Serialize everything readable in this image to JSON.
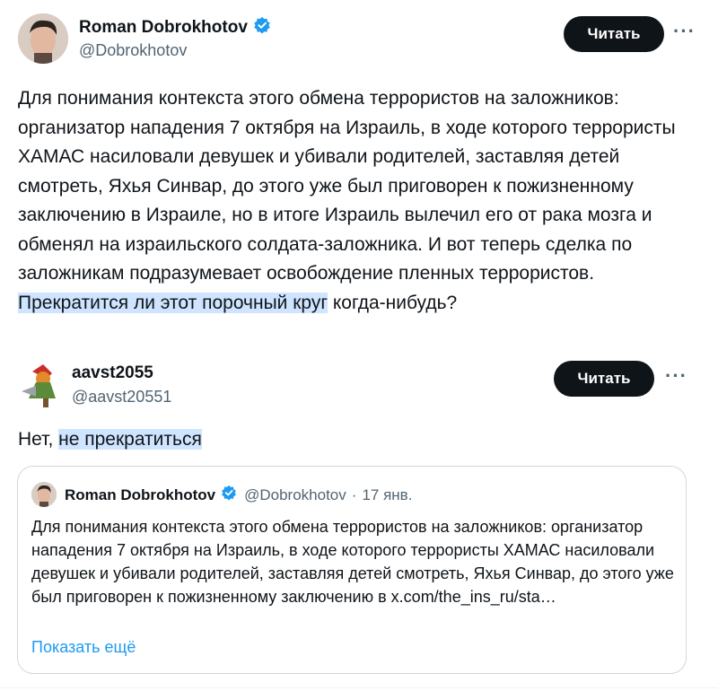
{
  "main_tweet": {
    "name": "Roman Dobrokhotov",
    "handle": "@Dobrokhotov",
    "follow_label": "Читать",
    "more_label": "···",
    "text_before": "Для понимания контекста этого обмена террористов на заложников: организатор нападения 7 октября на Израиль, в ходе которого террористы ХАМАС насиловали девушек и убивали родителей, заставляя детей смотреть, Яхья  Синвар, до этого уже был приговорен к пожизненному заключению в Израиле, но в итоге Израиль вылечил его от рака мозга и обменял на израильского солдата-заложника. И вот теперь сделка по заложникам подразумевает освобождение пленных террористов. ",
    "text_highlight": "Прекратится ли этот порочный круг",
    "text_after": " когда-нибудь?"
  },
  "reply_tweet": {
    "name": "aavst2055",
    "handle": "@aavst20551",
    "follow_label": "Читать",
    "more_label": "···",
    "text_before": "Нет, ",
    "text_highlight": "не прекратиться"
  },
  "quoted_tweet": {
    "name": "Roman Dobrokhotov",
    "handle": "@Dobrokhotov",
    "separator": "·",
    "date": "17 янв.",
    "text": "Для понимания контекста этого обмена террористов на заложников: организатор нападения 7 октября на Израиль, в ходе которого террористы ХАМАС насиловали девушек и убивали родителей, заставляя детей смотреть, Яхья  Синвар, до этого уже был приговорен к пожизненному заключению в x.com/the_ins_ru/sta…",
    "show_more": "Показать ещё"
  },
  "colors": {
    "text": "#0f1419",
    "secondary": "#536471",
    "link": "#1d9bf0",
    "highlight": "#cfe4ff",
    "verified": "#1d9bf0"
  }
}
